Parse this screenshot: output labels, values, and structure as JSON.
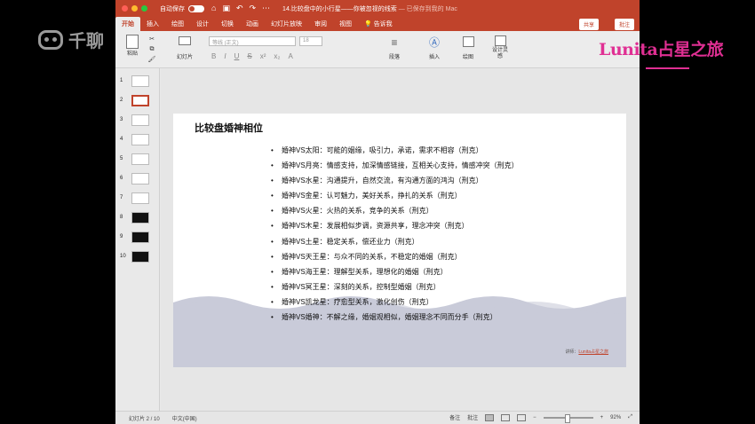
{
  "titlebar": {
    "autosave_label": "自动保存",
    "toggle_state": "关",
    "document_title": "14.比较盘中的小行星——你被忽视的线索",
    "save_status": "— 已保存到我的 Mac"
  },
  "ribbon": {
    "tabs": [
      "开始",
      "插入",
      "绘图",
      "设计",
      "切换",
      "动画",
      "幻灯片放映",
      "审阅",
      "视图",
      "告诉我"
    ],
    "active_tab": "开始",
    "share_label": "共享",
    "comment_label": "批注",
    "paste_label": "粘贴",
    "slide_label": "幻灯片",
    "font_placeholder": "等线 (正文)",
    "size_placeholder": "18",
    "paragraph_label": "段落",
    "insert_label": "插入",
    "draw_label": "绘图",
    "design_ideas_label": "设计灵感"
  },
  "thumbnails": [
    {
      "number": "1"
    },
    {
      "number": "2",
      "selected": true
    },
    {
      "number": "3"
    },
    {
      "number": "4"
    },
    {
      "number": "5"
    },
    {
      "number": "6"
    },
    {
      "number": "7"
    },
    {
      "number": "8"
    },
    {
      "number": "9"
    },
    {
      "number": "10"
    }
  ],
  "slide": {
    "title": "比较盘婚神相位",
    "bullets": [
      "婚神VS太阳：可能的姻缘，吸引力，承诺，需求不相容（刑克）",
      "婚神VS月亮：情感支持，加深情感链接，互相关心支持，情感冲突（刑克）",
      "婚神VS水星：沟通提升，自然交流，有沟通方面的鸿沟（刑克）",
      "婚神VS金星：认可魅力，美好关系，挣扎的关系（刑克）",
      "婚神VS火星：火热的关系，竞争的关系（刑克）",
      "婚神VS木星：发展相似步调，资源共享，理念冲突（刑克）",
      "婚神VS土星：稳定关系，偿还业力（刑克）",
      "婚神VS天王星：与众不同的关系，不稳定的婚姻（刑克）",
      "婚神VS海王星：理解型关系，理想化的婚姻（刑克）",
      "婚神VS冥王星：深刻的关系，控制型婚姻（刑克）",
      "婚神VS凯龙星：疗愈型关系，激化创伤（刑克）",
      "婚神VS婚神：不解之缘，婚姻观相似，婚姻理念不同而分手（刑克）"
    ],
    "credit_prefix": "讲师：",
    "credit_brand": "Lunita占星之旅"
  },
  "statusbar": {
    "slide_counter": "幻灯片 2 / 10",
    "language": "中文(中国)",
    "notes_label": "备注",
    "comments_label": "批注",
    "zoom": "92%"
  },
  "overlay": {
    "watermark_text": "千聊",
    "brand_text": "Lunita占星之旅"
  },
  "colors": {
    "accent": "#c0432b",
    "brand_pink": "#e02f93",
    "wave": "#c9cbd9"
  }
}
